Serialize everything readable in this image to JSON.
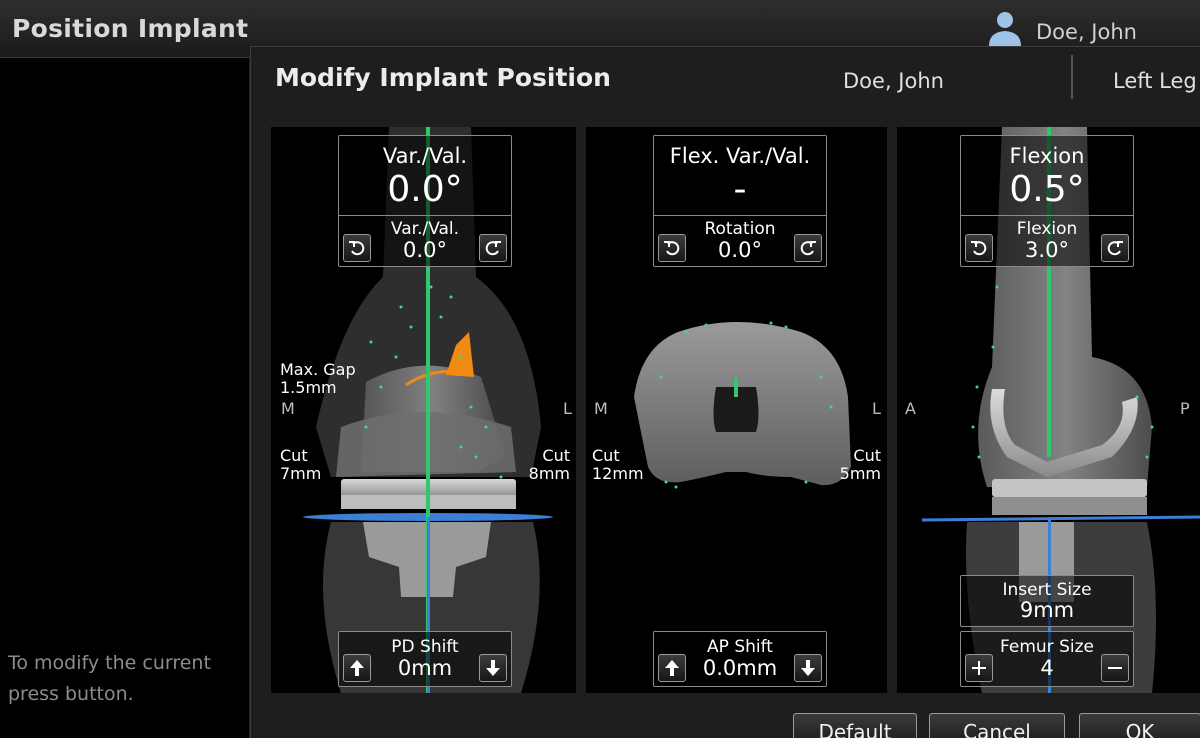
{
  "app": {
    "title": "Position Implant",
    "user": "Doe, John"
  },
  "sidebar": {
    "hint_line1": "To modify the current",
    "hint_line2": "press button."
  },
  "dialog": {
    "title": "Modify Implant Position",
    "patient": "Doe, John",
    "leg": "Left Leg",
    "panels": [
      {
        "top": {
          "title": "Var./Val.",
          "value": "0.0°",
          "sublabel": "Var./Val.",
          "subvalue": "0.0°"
        },
        "bottom": {
          "label": "PD Shift",
          "value": "0mm"
        },
        "left_side": "M",
        "right_side": "L",
        "gap_label": "Max. Gap",
        "gap_value": "1.5mm",
        "cut_left_label": "Cut",
        "cut_left_value": "7mm",
        "cut_right_label": "Cut",
        "cut_right_value": "8mm"
      },
      {
        "top": {
          "title": "Flex. Var./Val.",
          "value": "-",
          "sublabel": "Rotation",
          "subvalue": "0.0°"
        },
        "bottom": {
          "label": "AP Shift",
          "value": "0.0mm"
        },
        "left_side": "M",
        "right_side": "L",
        "cut_left_label": "Cut",
        "cut_left_value": "12mm",
        "cut_right_label": "Cut",
        "cut_right_value": "5mm"
      },
      {
        "top": {
          "title": "Flexion",
          "value": "0.5°",
          "sublabel": "Flexion",
          "subvalue": "3.0°"
        },
        "insert": {
          "label": "Insert Size",
          "value": "9mm"
        },
        "bottom": {
          "label": "Femur Size",
          "value": "4"
        },
        "left_side": "A",
        "right_side": "P"
      }
    ],
    "buttons": {
      "default": "Default",
      "cancel": "Cancel",
      "ok": "OK"
    }
  },
  "colors": {
    "axis_green": "#2ec96a",
    "axis_blue": "#3b7fd6",
    "gap_orange": "#f08a12",
    "points": "#3ddc84"
  }
}
